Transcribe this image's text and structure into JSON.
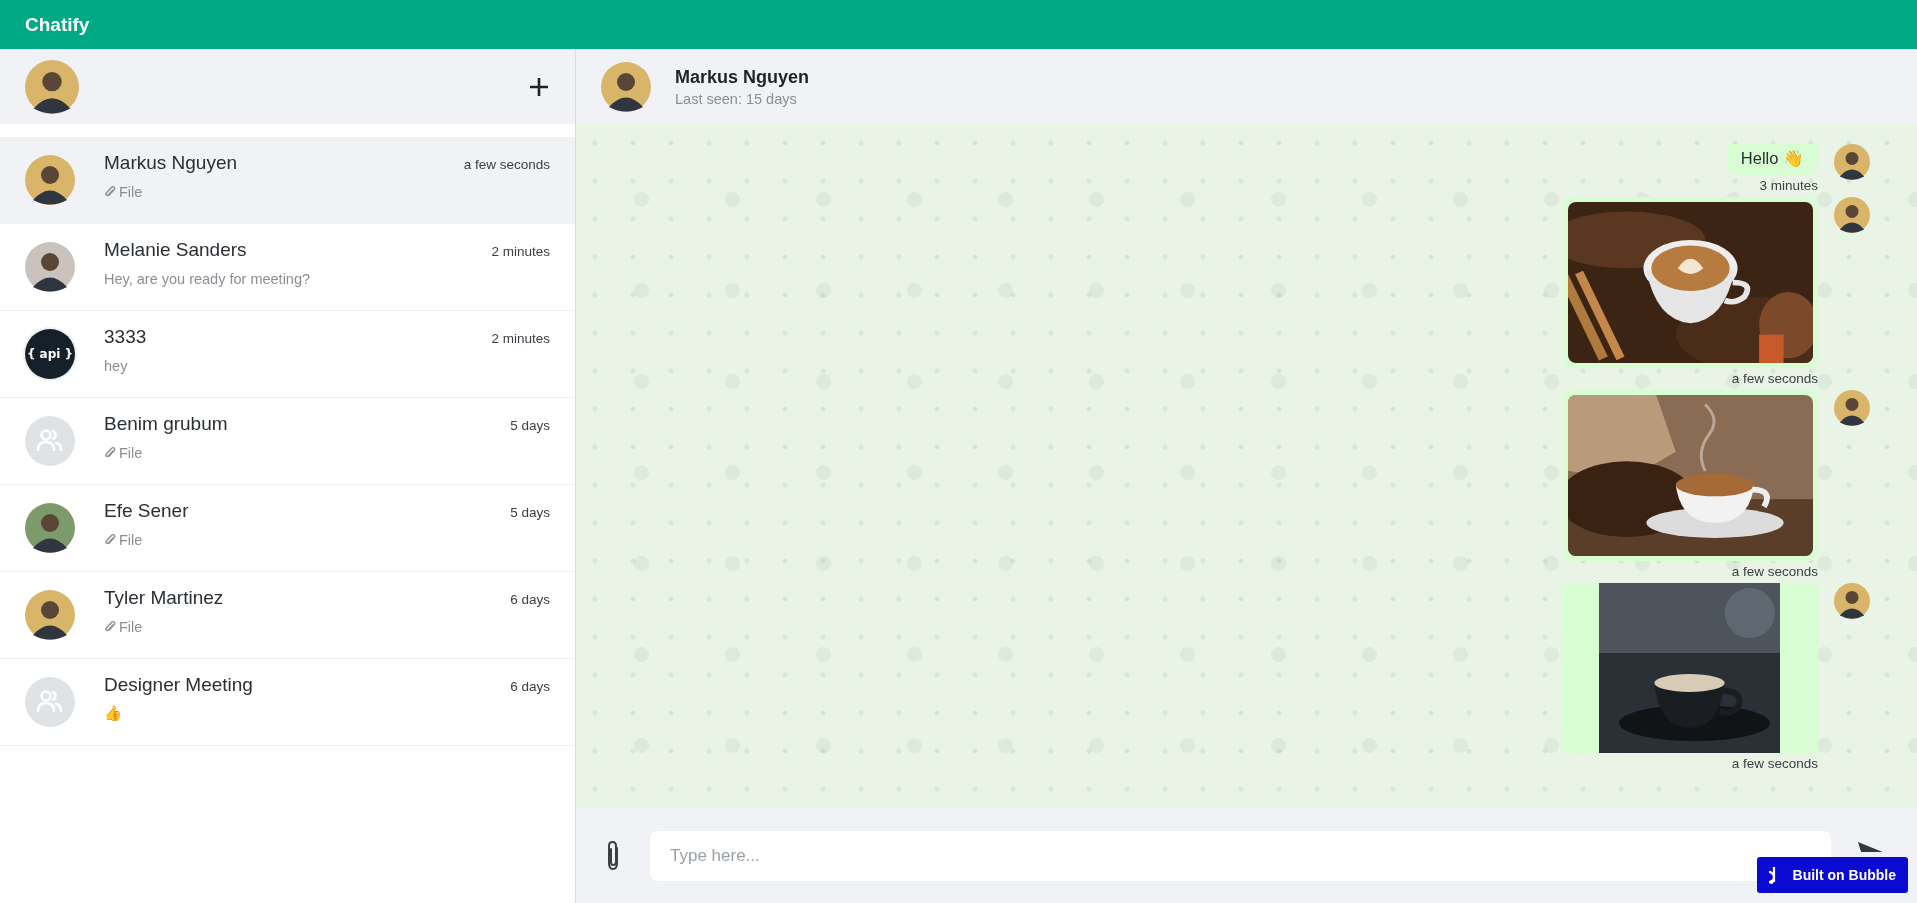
{
  "app": {
    "title": "Chatify"
  },
  "chats": [
    {
      "kind": "person",
      "name": "Markus Nguyen",
      "time": "a few seconds",
      "preview": "File",
      "attachment": true,
      "selected": true
    },
    {
      "kind": "person",
      "name": "Melanie Sanders",
      "time": "2 minutes",
      "preview": "Hey, are you ready for meeting?",
      "attachment": false,
      "selected": false
    },
    {
      "kind": "bot",
      "name": "3333",
      "time": "2 minutes",
      "preview": "hey",
      "attachment": false,
      "logo_text": "{ api }",
      "selected": false
    },
    {
      "kind": "group",
      "name": "Benim grubum",
      "time": "5 days",
      "preview": "File",
      "attachment": true,
      "selected": false
    },
    {
      "kind": "person",
      "name": "Efe Sener",
      "time": "5 days",
      "preview": "File",
      "attachment": true,
      "selected": false
    },
    {
      "kind": "person",
      "name": "Tyler Martinez",
      "time": "6 days",
      "preview": "File",
      "attachment": true,
      "selected": false
    },
    {
      "kind": "group",
      "name": "Designer Meeting",
      "time": "6 days",
      "preview": "👍",
      "attachment": false,
      "selected": false
    }
  ],
  "conversation": {
    "name": "Markus Nguyen",
    "status": "Last seen: 15 days"
  },
  "messages": [
    {
      "kind": "text",
      "text": "Hello 👋",
      "time": "3 minutes"
    },
    {
      "time": "a few seconds"
    },
    {
      "time": "a few seconds"
    },
    {
      "kind": "image_small",
      "time": "a few seconds"
    }
  ],
  "composer": {
    "placeholder": "Type here..."
  },
  "badge": {
    "label": "Built on Bubble"
  }
}
